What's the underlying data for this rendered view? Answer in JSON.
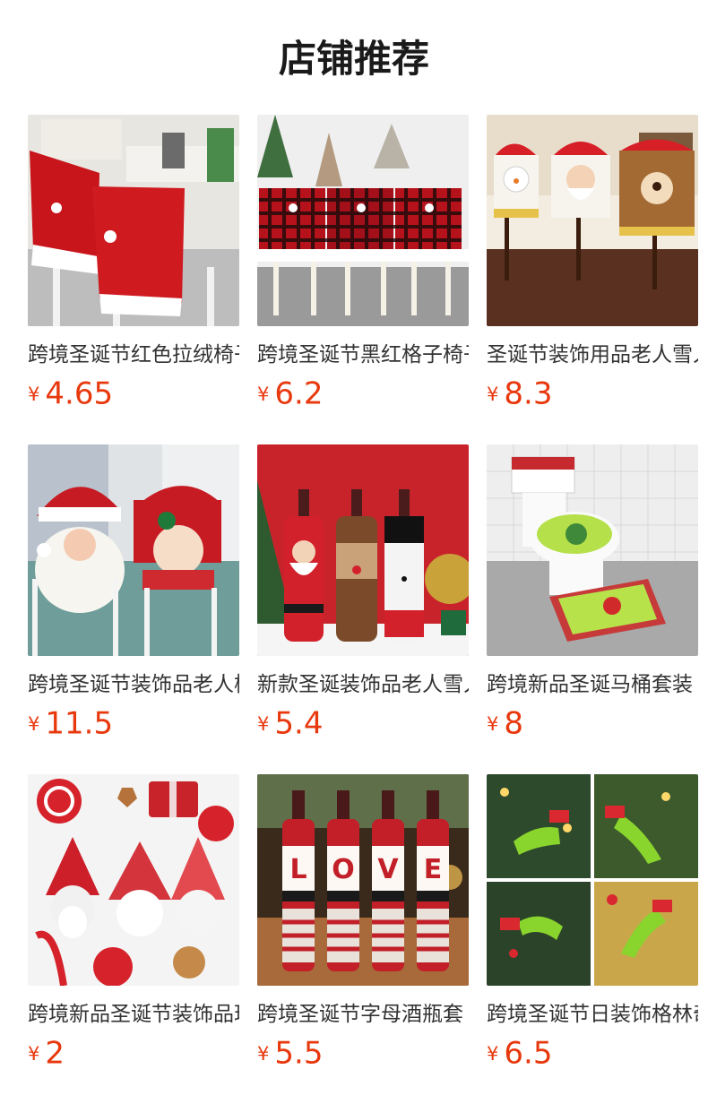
{
  "section": {
    "title": "店铺推荐",
    "currency": "¥"
  },
  "products": [
    {
      "name": "跨境圣诞节红色拉绒椅子套",
      "price": "4.65",
      "image": "red-santa-hat-chair-covers"
    },
    {
      "name": "跨境圣诞节黑红格子椅子套",
      "price": "6.2",
      "image": "plaid-chair-covers"
    },
    {
      "name": "圣诞节装饰用品老人雪人椅子套",
      "price": "8.3",
      "image": "snowman-santa-elk-chair-covers"
    },
    {
      "name": "跨境圣诞节装饰品老人椅子套",
      "price": "11.5",
      "image": "santa-mrs-claus-chair-covers"
    },
    {
      "name": "新款圣诞装饰品老人雪人酒瓶套",
      "price": "5.4",
      "image": "knitted-wine-bottle-covers"
    },
    {
      "name": "跨境新品圣诞马桶套装",
      "price": "8",
      "image": "grinch-toilet-set"
    },
    {
      "name": "跨境新品圣诞节装饰品玩偶",
      "price": "2",
      "image": "gnome-dolls"
    },
    {
      "name": "跨境圣诞节字母酒瓶套",
      "price": "5.5",
      "image": "love-letter-bottle-covers"
    },
    {
      "name": "跨境圣诞节日装饰格林奇腿",
      "price": "6.5",
      "image": "grinch-leg-decorations"
    }
  ]
}
